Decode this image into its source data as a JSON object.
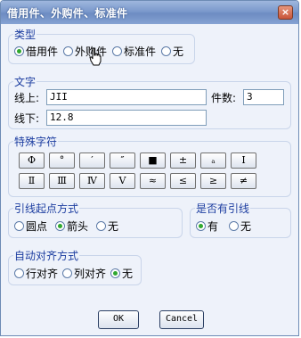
{
  "window": {
    "title": "借用件、外购件、标准件"
  },
  "type_group": {
    "label": "类型",
    "options": [
      "借用件",
      "外购件",
      "标准件",
      "无"
    ],
    "selected": "借用件"
  },
  "text_group": {
    "label": "文字",
    "line_up_label": "线上:",
    "line_up_value": "JII",
    "count_label": "件数:",
    "count_value": "3",
    "line_down_label": "线下:",
    "line_down_value": "12.8"
  },
  "special_chars": {
    "label": "特殊字符",
    "row1": [
      "Φ",
      "°",
      "′",
      "″",
      "■",
      "±",
      "ₐ",
      "Ⅰ"
    ],
    "row2": [
      "Ⅱ",
      "Ⅲ",
      "Ⅳ",
      "Ⅴ",
      "≈",
      "≤",
      "≥",
      "≠"
    ]
  },
  "leader_start": {
    "label": "引线起点方式",
    "options": [
      "圆点",
      "箭头",
      "无"
    ],
    "selected": "箭头"
  },
  "has_leader": {
    "label": "是否有引线",
    "options": [
      "有",
      "无"
    ],
    "selected": "有"
  },
  "auto_align": {
    "label": "自动对齐方式",
    "options": [
      "行对齐",
      "列对齐",
      "无"
    ],
    "selected": "无"
  },
  "buttons": {
    "ok": "OK",
    "cancel": "Cancel"
  },
  "icons": {
    "close": "×"
  }
}
